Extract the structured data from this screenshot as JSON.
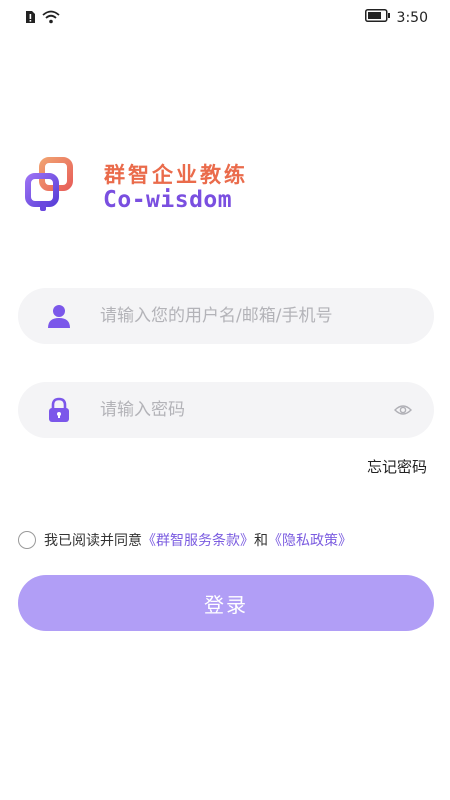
{
  "status_bar": {
    "time": "3:50"
  },
  "logo": {
    "cn": "群智企业教练",
    "en": "Co-wisdom"
  },
  "form": {
    "username_placeholder": "请输入您的用户名/邮箱/手机号",
    "password_placeholder": "请输入密码",
    "forgot_password": "忘记密码"
  },
  "agreement": {
    "prefix": "我已阅读并同意",
    "service_terms": "《群智服务条款》",
    "and": "和",
    "privacy_policy": "《隐私政策》"
  },
  "login_button": "登录",
  "colors": {
    "brand_orange": "#ea6b4b",
    "brand_purple": "#7a4fe0",
    "button": "#b19ef6",
    "icon": "#7b57ea",
    "link": "#7b5ce0"
  },
  "icons": [
    "sim-alert-icon",
    "wifi-icon",
    "battery-icon",
    "user-icon",
    "lock-icon",
    "eye-icon"
  ]
}
